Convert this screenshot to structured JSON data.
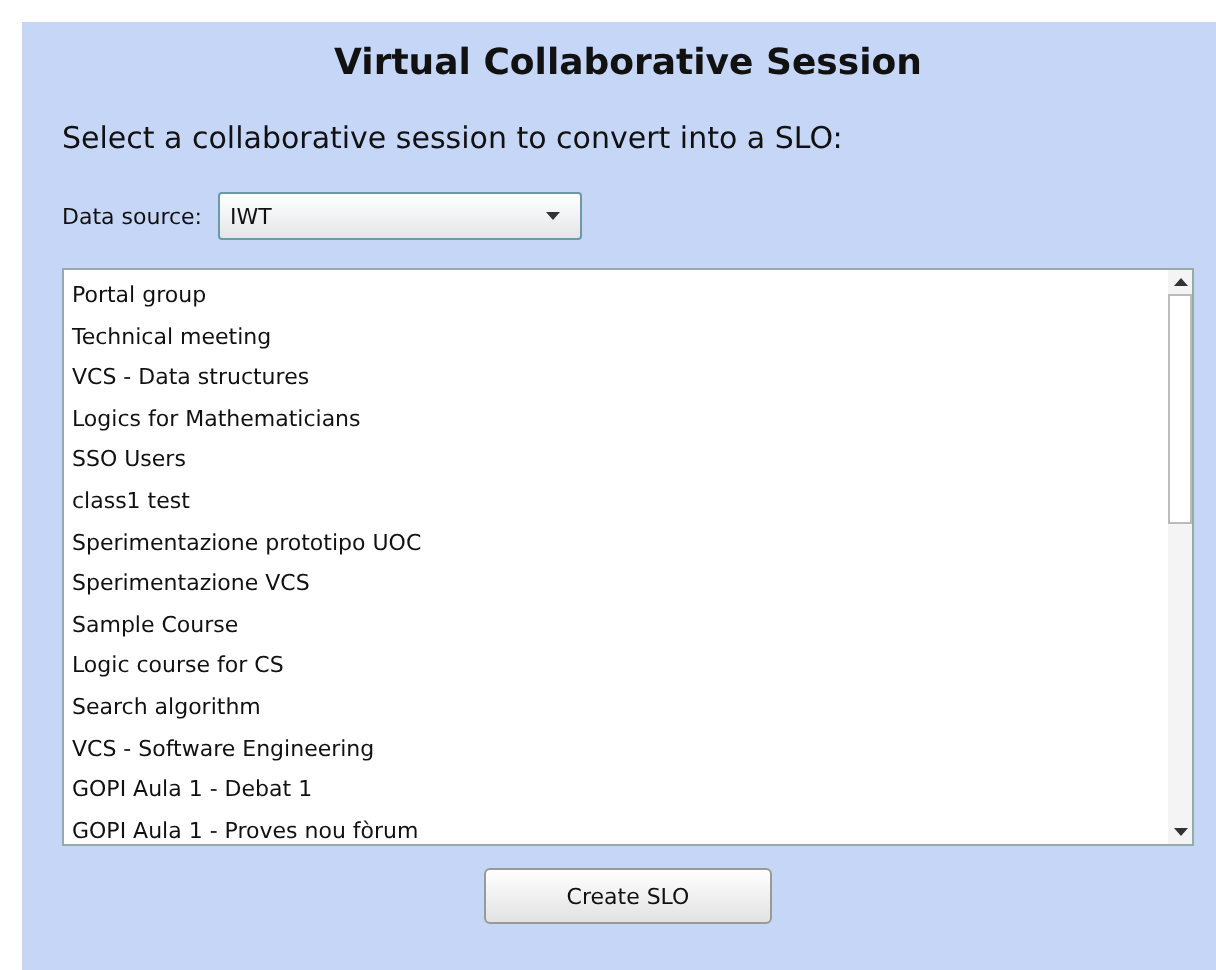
{
  "title": "Virtual Collaborative Session",
  "instruction": "Select a collaborative session to convert into a SLO:",
  "data_source": {
    "label": "Data source:",
    "value": "IWT"
  },
  "sessions": [
    {
      "label": "Portal group"
    },
    {
      "label": "Technical meeting"
    },
    {
      "label": "VCS - Data structures"
    },
    {
      "label": "Logics for Mathematicians"
    },
    {
      "label": "SSO Users"
    },
    {
      "label": "class1 test"
    },
    {
      "label": "Sperimentazione prototipo UOC"
    },
    {
      "label": "Sperimentazione VCS"
    },
    {
      "label": "Sample Course"
    },
    {
      "label": "Logic course for CS"
    },
    {
      "label": "Search algorithm"
    },
    {
      "label": "VCS - Software Engineering"
    },
    {
      "label": "GOPI Aula 1 - Debat 1"
    },
    {
      "label": "GOPI Aula 1 - Proves nou fòrum"
    }
  ],
  "button": "Create SLO"
}
